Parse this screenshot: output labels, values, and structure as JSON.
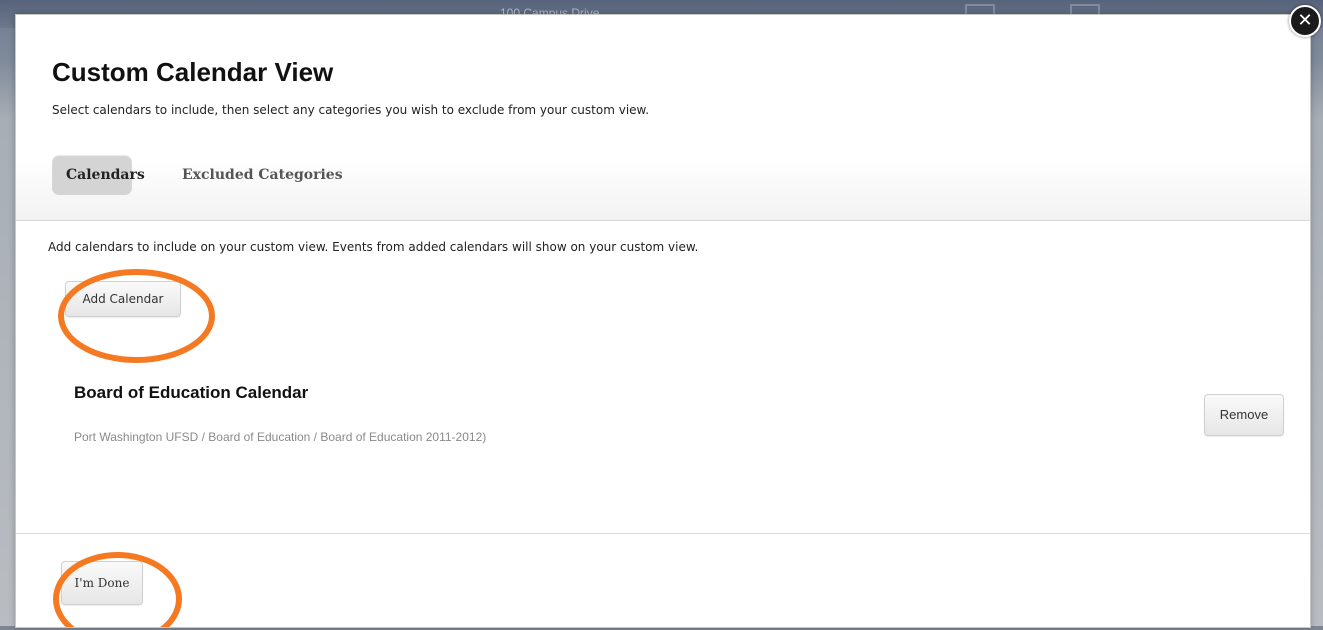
{
  "background": {
    "address_text": "100 Campus Drive"
  },
  "modal": {
    "title": "Custom Calendar View",
    "subtitle": "Select calendars to include, then select any categories you wish to exclude from your custom view.",
    "tabs": [
      {
        "label": "Calendars",
        "active": true
      },
      {
        "label": "Excluded Categories",
        "active": false
      }
    ],
    "intro": "Add calendars to include on your custom view. Events from added calendars will show on your custom view.",
    "add_button_label": "Add Calendar",
    "calendar": {
      "name": "Board of Education Calendar",
      "path": "Port Washington UFSD / Board of Education / Board of Education 2011-2012)",
      "remove_label": "Remove"
    },
    "done_label": "I'm Done",
    "close_glyph": "✕"
  },
  "annotation_color": "#f47920"
}
